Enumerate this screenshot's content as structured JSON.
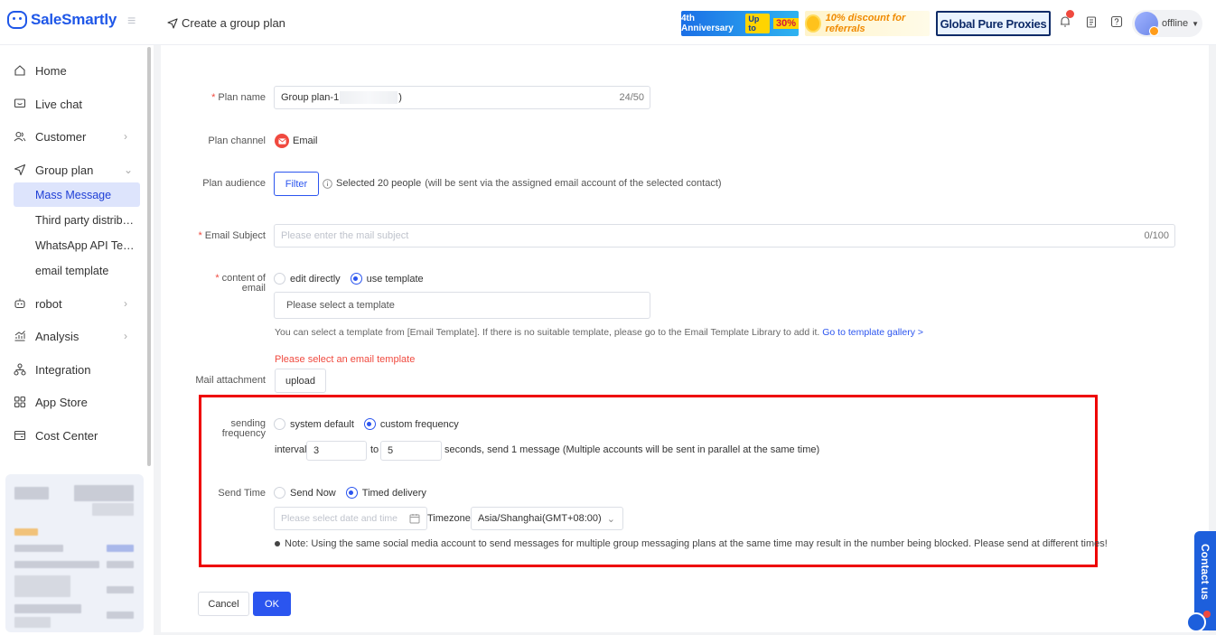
{
  "app": {
    "name": "SaleSmartly"
  },
  "header": {
    "page_title": "Create a group plan",
    "banners": {
      "anniversary": "4th Anniversary",
      "anniversary_tag": "Up to",
      "anniversary_pct": "30%",
      "referral": "10% discount for referrals",
      "proxy": "Global Pure Proxies"
    },
    "user_status": "offline"
  },
  "sidebar": {
    "items": [
      {
        "label": "Home",
        "icon": "home-icon"
      },
      {
        "label": "Live chat",
        "icon": "chat-icon"
      },
      {
        "label": "Customer",
        "icon": "customer-icon"
      },
      {
        "label": "Group plan",
        "icon": "send-icon"
      },
      {
        "label": "robot",
        "icon": "robot-icon"
      },
      {
        "label": "Analysis",
        "icon": "analysis-icon"
      },
      {
        "label": "Integration",
        "icon": "integration-icon"
      },
      {
        "label": "App Store",
        "icon": "app-store-icon"
      },
      {
        "label": "Cost Center",
        "icon": "cost-center-icon"
      }
    ],
    "sub_items": [
      "Mass Message",
      "Third party distrib…",
      "WhatsApp API Te…",
      "email template"
    ]
  },
  "form": {
    "plan_name": {
      "label": "Plan name",
      "value_prefix": "Group plan-1",
      "value_suffix": ")",
      "counter": "24/50"
    },
    "plan_channel": {
      "label": "Plan channel",
      "value": "Email"
    },
    "plan_audience": {
      "label": "Plan audience",
      "button": "Filter",
      "info": "Selected 20 people",
      "info_note": " (will be sent via the assigned email account of the selected contact)"
    },
    "email_subject": {
      "label": "Email Subject",
      "placeholder": "Please enter the mail subject",
      "counter": "0/100"
    },
    "content": {
      "label_line1": "content of",
      "label_line2": "email",
      "options": [
        "edit directly",
        "use template"
      ],
      "selected": "use template",
      "template_placeholder": "Please select a template",
      "hint": "You can select a template from [Email Template]. If there is no suitable template, please go to the Email Template Library to add it.",
      "hint_link": "Go to template gallery >",
      "error": "Please select an email template"
    },
    "attachment": {
      "label": "Mail attachment",
      "button": "upload"
    },
    "frequency": {
      "label_line1": "sending",
      "label_line2": "frequency",
      "options": [
        "system default",
        "custom frequency"
      ],
      "selected": "custom frequency",
      "interval_label": "interval",
      "interval_from": "3",
      "to_label": "to",
      "interval_to": "5",
      "suffix": "seconds, send 1 message",
      "suffix_note": "(Multiple accounts will be sent in parallel at the same time)"
    },
    "send_time": {
      "label": "Send Time",
      "options": [
        "Send Now",
        "Timed delivery"
      ],
      "selected": "Timed delivery",
      "date_placeholder": "Please select date and time",
      "timezone_label": "Timezone",
      "timezone_value": "Asia/Shanghai(GMT+08:00)",
      "note": "Note: Using the same social media account to send messages for multiple group messaging plans at the same time may result in the number being blocked. Please send at different times!"
    },
    "actions": {
      "cancel": "Cancel",
      "ok": "OK"
    }
  },
  "contact_tab": {
    "label": "Contact us"
  },
  "colors": {
    "brand": "#1f57e8",
    "primary": "#2b55ef",
    "error": "#f04a3f",
    "highlight": "#ee0000"
  }
}
